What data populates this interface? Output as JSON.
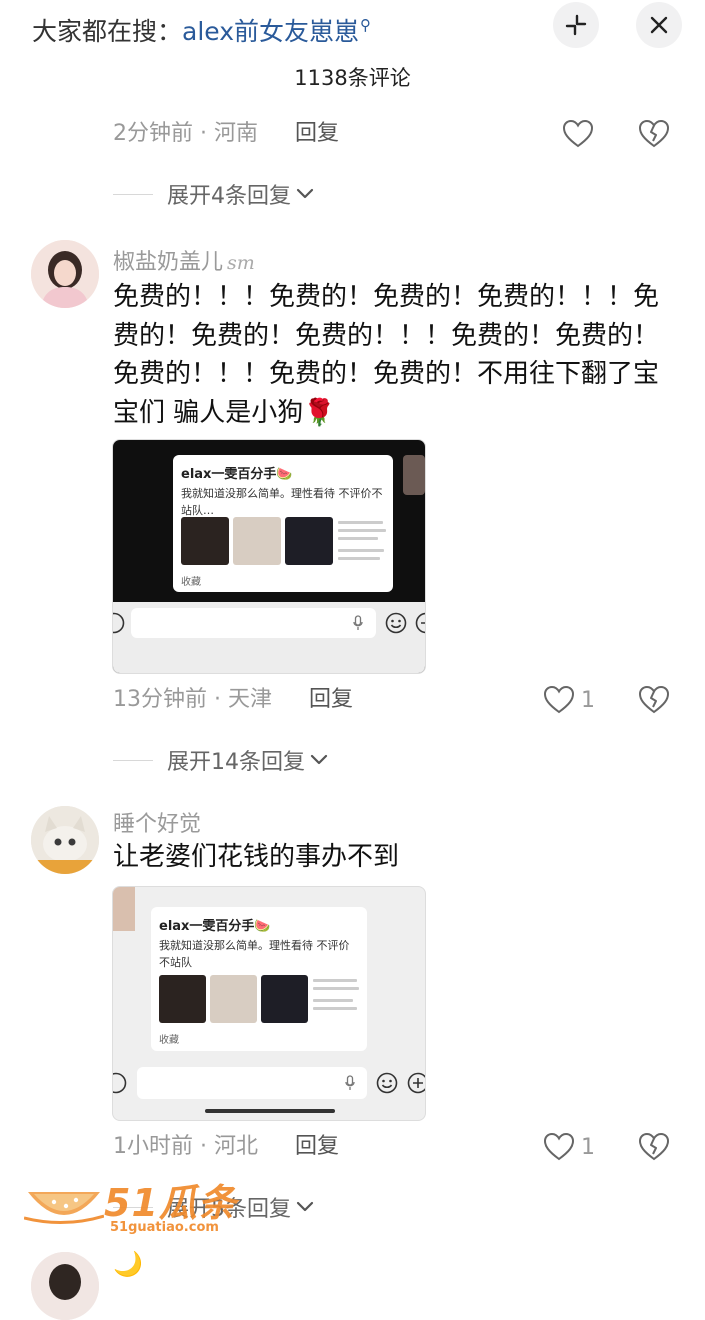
{
  "top_bar": {
    "search_prefix": "大家都在搜：",
    "search_term": "alex前女友崽崽",
    "search_glyph": "⚲",
    "collapse_icon": "collapse-arrows-icon",
    "close_icon": "close-icon"
  },
  "comment_count": "1138条评论",
  "comments": [
    {
      "time": "2分钟前",
      "location": "河南",
      "reply_label": "回复",
      "likes": "",
      "expand_label": "展开4条回复"
    },
    {
      "username": "椒盐奶盖儿",
      "user_tag": "sm",
      "text": "免费的！！！免费的！免费的！免费的！！！免费的！免费的！免费的！！！免费的！免费的！免费的！！！免费的！免费的！不用往下翻了宝宝们 骗人是小狗",
      "emoji": "🌹",
      "screenshot": {
        "card_title": "elax一雯百分手🍉",
        "card_text": "我就知道没那么简单。理性看待 不评价不站队…",
        "collect_label": "收藏"
      },
      "time": "13分钟前",
      "location": "天津",
      "reply_label": "回复",
      "likes": "1",
      "expand_label": "展开14条回复"
    },
    {
      "username": "睡个好觉",
      "text": "让老婆们花钱的事办不到",
      "screenshot": {
        "card_title": "elax一雯百分手🍉",
        "card_text": "我就知道没那么简单。理性看待 不评价不站队",
        "collect_label": "收藏"
      },
      "time": "1小时前",
      "location": "河北",
      "reply_label": "回复",
      "likes": "1",
      "expand_label": "展开5条回复"
    }
  ],
  "watermark": {
    "brand": "51瓜条",
    "url": "51guatiao.com"
  },
  "next_comment_emoji": "🌙",
  "colors": {
    "accent_link": "#2a5a9a",
    "meta_text": "#999999",
    "watermark_orange": "#f08a2c"
  }
}
